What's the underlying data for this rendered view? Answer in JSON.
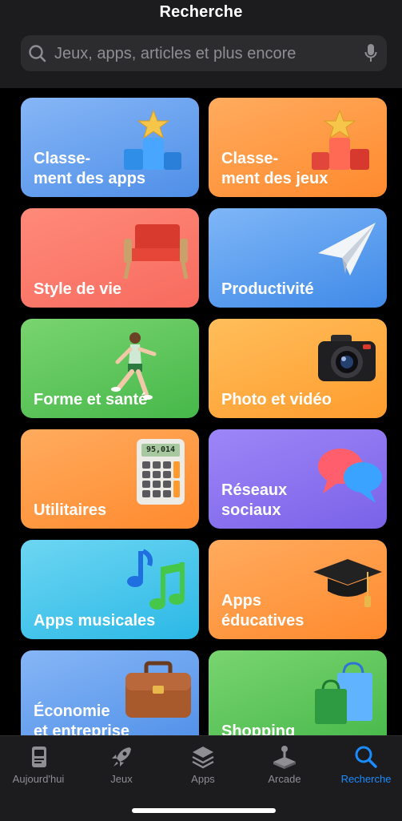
{
  "header": {
    "title": "Recherche",
    "search_placeholder": "Jeux, apps, articles et plus encore",
    "search_icon": "magnifying-glass",
    "mic_icon": "microphone"
  },
  "categories": [
    {
      "label": "Classe-\nment des apps",
      "icon": "podium-blue",
      "color_from": "#86b6f6",
      "color_to": "#4f8fe8"
    },
    {
      "label": "Classe-\nment des jeux",
      "icon": "podium-red",
      "color_from": "#ffab5e",
      "color_to": "#ff8a2e"
    },
    {
      "label": "Style de vie",
      "icon": "armchair",
      "color_from": "#ff8a7a",
      "color_to": "#f76b5e"
    },
    {
      "label": "Productivité",
      "icon": "paper-plane",
      "color_from": "#7fb6f7",
      "color_to": "#3f8ae8"
    },
    {
      "label": "Forme et santé",
      "icon": "runner",
      "color_from": "#79d46f",
      "color_to": "#46b84a"
    },
    {
      "label": "Photo et vidéo",
      "icon": "camera",
      "color_from": "#ffbe5a",
      "color_to": "#ff9c2e"
    },
    {
      "label": "Utilitaires",
      "icon": "calculator",
      "color_from": "#ffab5e",
      "color_to": "#ff8a2e"
    },
    {
      "label": "Réseaux\nsociaux",
      "icon": "speech-bubbles",
      "color_from": "#9d86f7",
      "color_to": "#7a62e8"
    },
    {
      "label": "Apps musicales",
      "icon": "music-notes",
      "color_from": "#6dd6f2",
      "color_to": "#2bb8e6"
    },
    {
      "label": "Apps\néducatives",
      "icon": "graduation-cap",
      "color_from": "#ffab5e",
      "color_to": "#ff8a2e"
    },
    {
      "label": "Économie\net entreprise",
      "icon": "briefcase",
      "color_from": "#86b6f6",
      "color_to": "#4f8fe8"
    },
    {
      "label": "Shopping",
      "icon": "shopping-bags",
      "color_from": "#79d46f",
      "color_to": "#46b84a"
    }
  ],
  "calculator_display": "95,014",
  "tabs": [
    {
      "label": "Aujourd'hui",
      "icon": "today-card",
      "active": false
    },
    {
      "label": "Jeux",
      "icon": "rocket",
      "active": false
    },
    {
      "label": "Apps",
      "icon": "app-stack",
      "active": false
    },
    {
      "label": "Arcade",
      "icon": "joystick",
      "active": false
    },
    {
      "label": "Recherche",
      "icon": "magnifying-glass",
      "active": true
    }
  ],
  "colors": {
    "active_tab": "#1a8cff",
    "inactive_tab": "#8e8e93"
  }
}
